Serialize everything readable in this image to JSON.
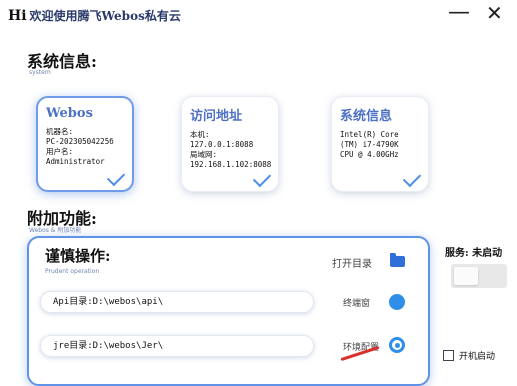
{
  "window": {
    "title_prefix": "Hi",
    "title_text": "欢迎使用腾飞Webos私有云",
    "minimize_icon": "minimize-icon",
    "close_icon": "close-icon"
  },
  "system_section": {
    "title": "系统信息:",
    "subtitle": "system"
  },
  "cards": [
    {
      "title": "Webos",
      "lines": [
        "机器名:",
        "PC-20230504225б",
        "用户名:",
        "Administrator"
      ],
      "selected": true
    },
    {
      "title": "访问地址",
      "lines": [
        "本机:",
        "127.0.0.1:8088",
        "局域网:",
        "192.168.1.102:8088"
      ],
      "selected": false
    },
    {
      "title": "系统信息",
      "lines": [
        "Intel(R) Core",
        "(TM) i7-4790K",
        "CPU @ 4.00GHz"
      ],
      "selected": false
    }
  ],
  "addon_section": {
    "title": "附加功能:",
    "subtitle": "Webos & 附加功能"
  },
  "operations": {
    "title": "谨慎操作:",
    "subtitle": "Prudent operation",
    "open_dir_label": "打开目录",
    "api_path": "Api目录:D:\\webos\\api\\",
    "api_action": "终端窗",
    "jre_path": "jre目录:D:\\webos\\Jer\\",
    "jre_action": "环境配置"
  },
  "service": {
    "status_text": "服务: 未启动",
    "autostart_label": "开机启动",
    "toggle_on": false
  }
}
